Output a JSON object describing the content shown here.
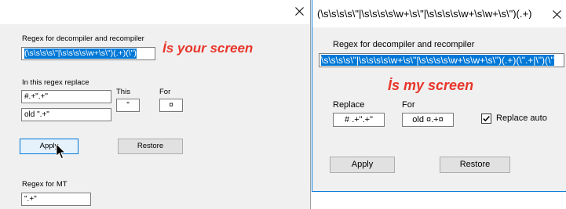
{
  "theme": {
    "accent": "#0078d7",
    "selection_bg": "#0078d7",
    "caption_red": "#e8362a",
    "window_bg": "#f0f0f0"
  },
  "icons": {
    "close": "close-icon",
    "pointer": "mouse-pointer-icon",
    "check": "checkmark-icon"
  },
  "left_window": {
    "caption": "İs your screen",
    "regex_label": "Regex for decompiler and recompiler",
    "regex_value": "(\\s\\s\\s\\s\\\"|\\s\\s\\s\\s\\w+\\s\\\")(.+)(\\\")",
    "replace_group_label": "In this regex replace",
    "replace_value": "#.+\".+\"",
    "replace_with_value": "old \".+\"",
    "this_label": "This",
    "this_value": "\"",
    "for_label": "For",
    "for_value": "¤",
    "apply_label": "Apply",
    "restore_label": "Restore",
    "mt_label": "Regex for MT",
    "mt_value": "\".+\""
  },
  "right_window": {
    "title": "(\\s\\s\\s\\s\\\"|\\s\\s\\s\\s\\w+\\s\\\"|\\s\\s\\s\\s\\w+\\s\\w+\\s\\\")(.+)",
    "caption": "İs my screen",
    "regex_label": "Regex for decompiler and recompiler",
    "regex_value": "\\s\\s\\s\\s\\\"|\\s\\s\\s\\s\\w+\\s\\\"|\\s\\s\\s\\s\\w+\\s\\w+\\s\\\")(.+)(\\\".+|\\\")(\\\"",
    "replace_label": "Replace",
    "replace_value": "# .+\".+\"",
    "for_label": "For",
    "for_value": "old ¤.+¤",
    "replace_auto_label": "Replace auto",
    "replace_auto_checked": true,
    "apply_label": "Apply",
    "restore_label": "Restore"
  }
}
